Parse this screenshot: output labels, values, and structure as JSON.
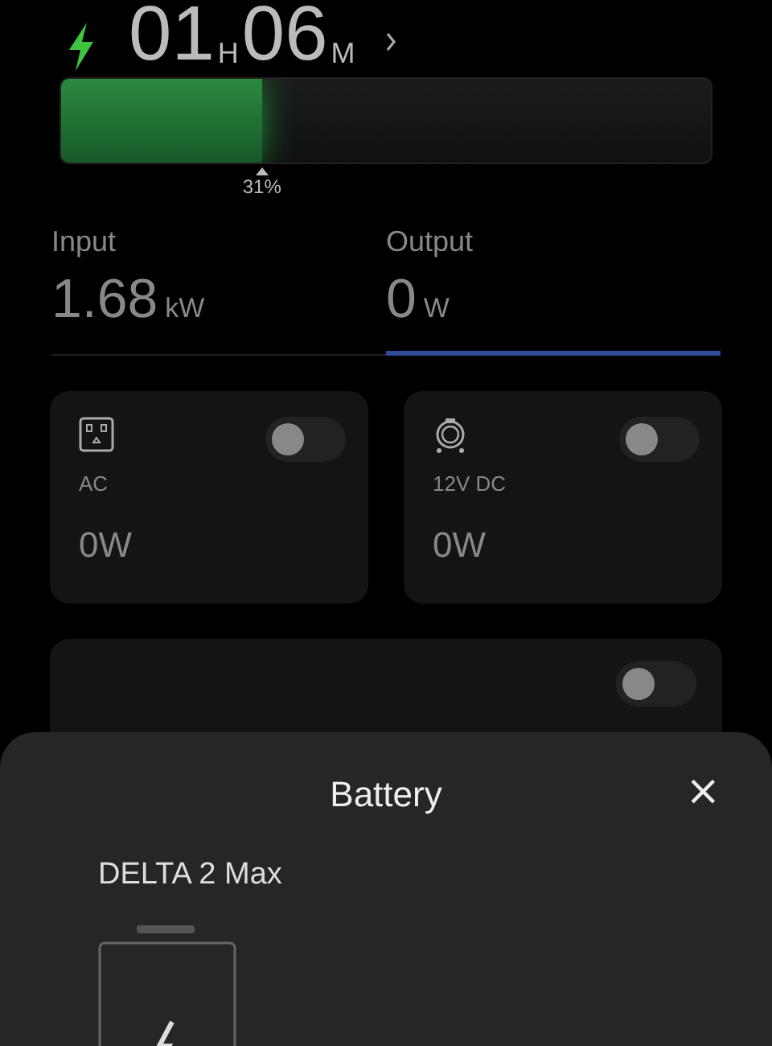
{
  "remaining_time": {
    "hours": "01",
    "hours_unit": "H",
    "minutes": "06",
    "minutes_unit": "M",
    "charging": true
  },
  "battery_bar": {
    "level": 0.31,
    "reading": "31%"
  },
  "tabs": [
    {
      "label": "Input",
      "value": "1.68",
      "unit": "kW",
      "selected": false
    },
    {
      "label": "Output",
      "value": "0",
      "unit": "W",
      "selected": true
    }
  ],
  "outputs": [
    {
      "kind": "ac",
      "label": "AC",
      "power": "0W",
      "on": false
    },
    {
      "kind": "dc",
      "label": "12V DC",
      "power": "0W",
      "on": false
    }
  ],
  "extra_card": {
    "on": false
  },
  "sheet": {
    "title": "Battery",
    "close": "×",
    "device": "DELTA 2 Max"
  }
}
